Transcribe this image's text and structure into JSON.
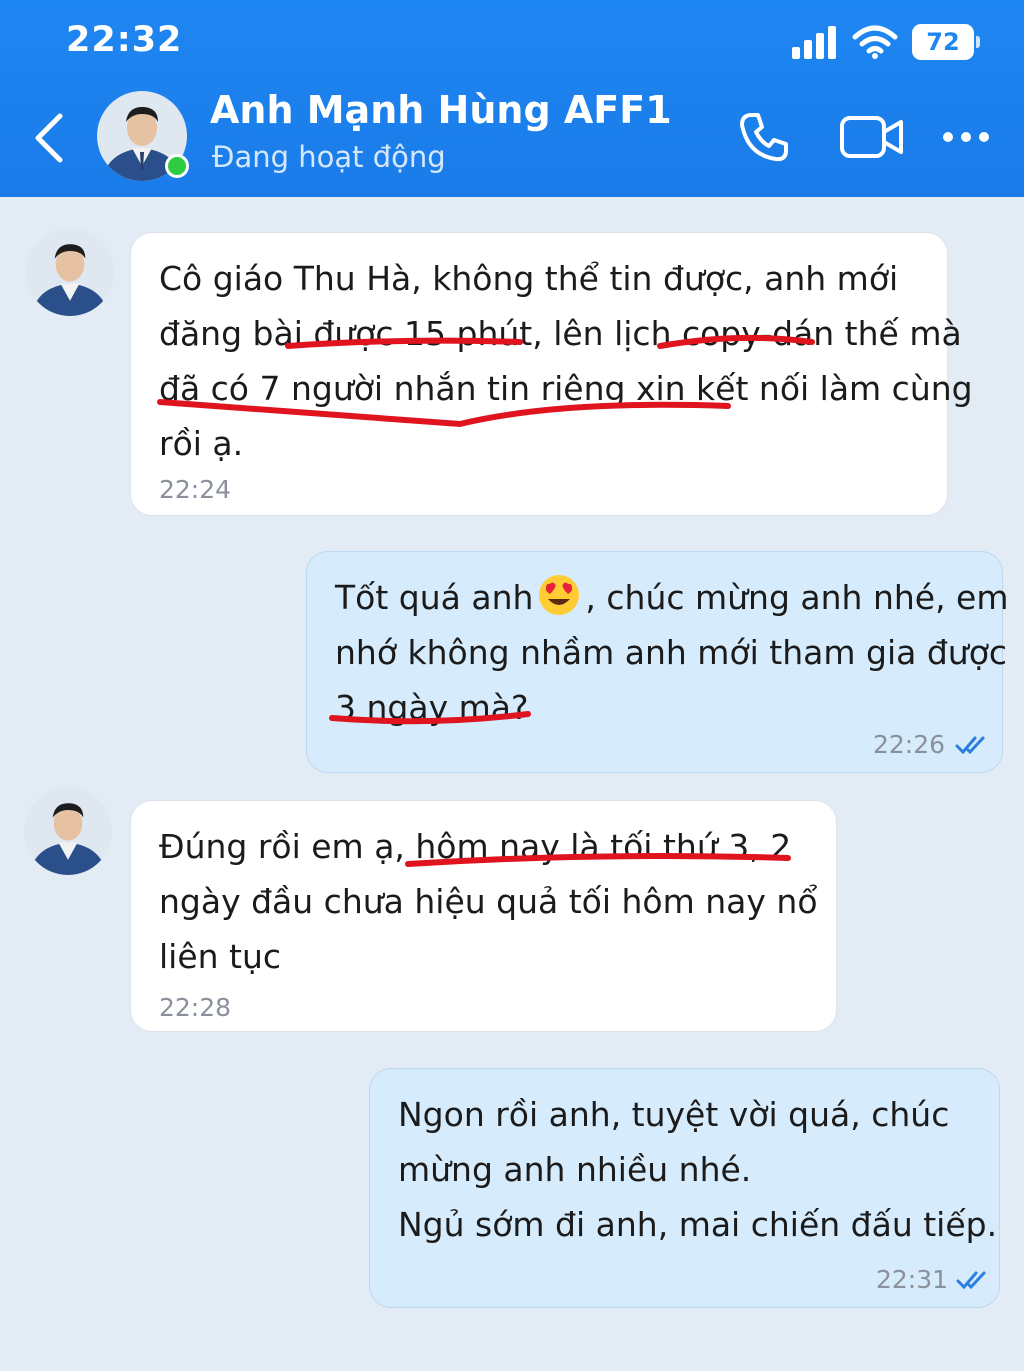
{
  "status_bar": {
    "time": "22:32",
    "battery": "72"
  },
  "header": {
    "contact_name": "Anh Mạnh Hùng AFF1",
    "contact_status": "Đang hoạt động"
  },
  "messages": [
    {
      "direction": "incoming",
      "lines": [
        "Cô giáo Thu Hà, không thể tin được, anh mới",
        "đăng bài được 15 phút, lên lịch copy-dán thế mà",
        "đã có 7 người nhắn tin riêng xin kết nối làm cùng",
        "rồi ạ."
      ],
      "time": "22:24"
    },
    {
      "direction": "outgoing",
      "lines": [
        "Tốt quá anh",
        ", chúc mừng anh nhé, em",
        "nhớ không nhầm anh mới tham gia được",
        "3 ngày mà?"
      ],
      "time": "22:26"
    },
    {
      "direction": "incoming",
      "lines": [
        "Đúng rồi em ạ, hôm nay là tối thứ 3, 2",
        "ngày đầu chưa hiệu quả tối hôm nay nổ",
        "liên tục"
      ],
      "time": "22:28"
    },
    {
      "direction": "outgoing",
      "lines": [
        "Ngon rồi anh, tuyệt vời quá, chúc",
        "mừng anh nhiều nhé.",
        "Ngủ sớm đi anh, mai chiến đấu tiếp."
      ],
      "time": "22:31"
    }
  ],
  "colors": {
    "header": "#1e86f2",
    "outgoing_bubble": "#d6ebfb",
    "incoming_bubble": "#ffffff",
    "underline": "#e0141e",
    "read_check": "#2a7fe0"
  },
  "icons": [
    "back-chevron-icon",
    "phone-icon",
    "video-call-icon",
    "more-icon",
    "signal-icon",
    "wifi-icon",
    "battery-icon",
    "heart-eyes-emoji",
    "double-check-icon"
  ]
}
